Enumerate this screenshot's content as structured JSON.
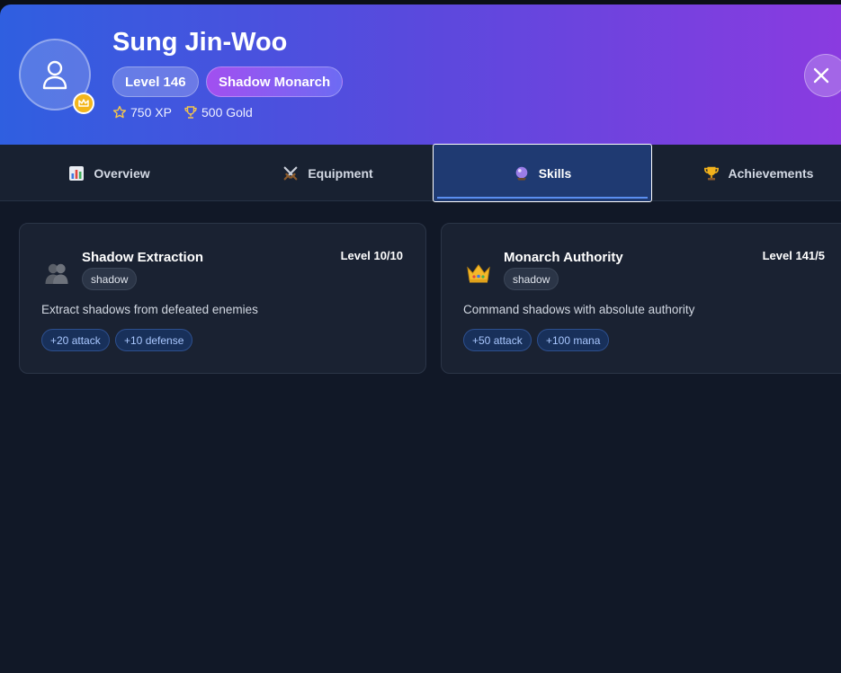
{
  "profile": {
    "name": "Sung Jin-Woo",
    "level_label": "Level 146",
    "title_label": "Shadow Monarch",
    "xp_label": "750 XP",
    "gold_label": "500 Gold"
  },
  "tabs": [
    {
      "label": "Overview",
      "icon": "bar-chart-icon",
      "active": false
    },
    {
      "label": "Equipment",
      "icon": "crossed-swords-icon",
      "active": false
    },
    {
      "label": "Skills",
      "icon": "crystal-ball-icon",
      "active": true
    },
    {
      "label": "Achievements",
      "icon": "trophy-icon",
      "active": false
    }
  ],
  "skills": [
    {
      "title": "Shadow Extraction",
      "icon": "shadows-icon",
      "level": "Level 10/10",
      "tag": "shadow",
      "description": "Extract shadows from defeated enemies",
      "effects": [
        "+20 attack",
        "+10 defense"
      ]
    },
    {
      "title": "Monarch Authority",
      "icon": "crown-icon",
      "level": "Level 141/5",
      "tag": "shadow",
      "description": "Command shadows with absolute authority",
      "effects": [
        "+50 attack",
        "+100 mana"
      ]
    }
  ],
  "colors": {
    "header_gradient_start": "#2f5fe0",
    "header_gradient_end": "#8a3be0",
    "active_tab": "#1f3a72",
    "background": "#111827",
    "card": "#1a2232",
    "gold": "#f3b61c"
  }
}
